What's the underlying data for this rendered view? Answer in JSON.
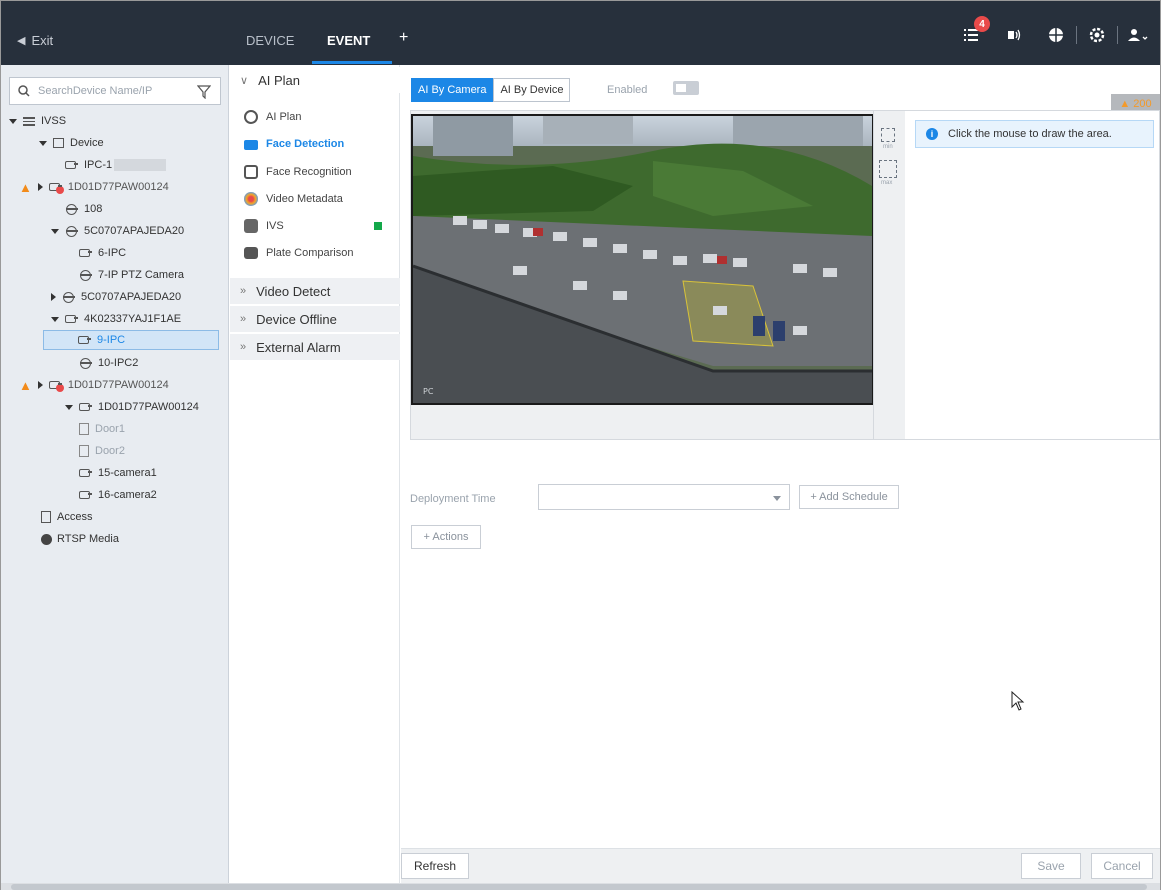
{
  "topbar": {
    "exit_label": "Exit",
    "tabs": [
      {
        "label": "DEVICE",
        "active": false
      },
      {
        "label": "EVENT",
        "active": true
      }
    ],
    "add_tab": "+",
    "alarm_count": "4",
    "icons": [
      "alarm-list-icon",
      "speaker-icon",
      "network-icon",
      "settings-icon",
      "user-icon"
    ],
    "accent_color": "#1c87e6"
  },
  "left_panel": {
    "search_placeholder": "SearchDevice Name/IP",
    "tree": [
      {
        "label": "IVSS"
      },
      {
        "label": "Device"
      },
      {
        "label": "IPC-1"
      },
      {
        "label": "1D01D77PAW00124"
      },
      {
        "label": "108"
      },
      {
        "label": "5C0707APAJEDA20"
      },
      {
        "label": "6-IPC"
      },
      {
        "label": "7-IP PTZ Camera"
      },
      {
        "label": "5C0707APAJEDA20"
      },
      {
        "label": "4K02337YAJ1F1AE"
      },
      {
        "label": "9-IPC"
      },
      {
        "label": "10-IPC2"
      },
      {
        "label": "1D01D77PAW00124"
      },
      {
        "label": "1D01D77PAW00124"
      },
      {
        "label": "Door1"
      },
      {
        "label": "Door2"
      },
      {
        "label": "15-camera1"
      },
      {
        "label": "16-camera2"
      },
      {
        "label": "Access"
      },
      {
        "label": "RTSP Media"
      }
    ]
  },
  "event_menu": {
    "ai_plan_group": "AI Plan",
    "items": [
      {
        "label": "AI Plan"
      },
      {
        "label": "Face Detection"
      },
      {
        "label": "Face Recognition"
      },
      {
        "label": "Video Metadata"
      },
      {
        "label": "IVS"
      },
      {
        "label": "Plate Comparison"
      }
    ],
    "groups": [
      "Video Detect",
      "Device Offline",
      "External Alarm"
    ]
  },
  "content": {
    "tab_by_camera": "AI By Camera",
    "tab_by_device": "AI By Device",
    "enabled_label": "Enabled",
    "alert_count": "200",
    "hint": "Click the mouse to draw the area.",
    "video_overlay": "PC",
    "tool_min": "min",
    "tool_max": "max",
    "deployment_label": "Deployment Time",
    "add_schedule": "+ Add Schedule",
    "actions": "+ Actions"
  },
  "footer": {
    "refresh": "Refresh",
    "save": "Save",
    "cancel": "Cancel"
  }
}
